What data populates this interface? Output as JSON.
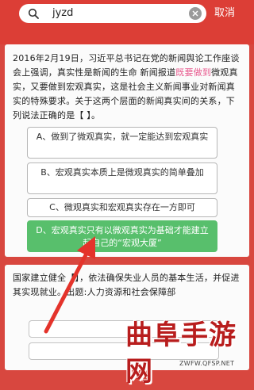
{
  "search": {
    "query": "jyzd",
    "cancel_label": "取消"
  },
  "question1": {
    "text_part1": "2016年2月19日，习近平总书记在党的新闻舆论工作座谈会上强调，真实性是新闻的生命 新闻报道",
    "highlight": "既要做到",
    "text_part2": "微观真实，又要做到宏观真实，这是社会主义新闻事业对新闻真实的特殊要求。关于这两个层面的新闻真实间的关系，下列说法正确的是【 】。",
    "options": [
      {
        "label": "A、做到了微观真实，就一定能达到宏观真实"
      },
      {
        "label": "B、宏观真实本质上是微观真实的简单叠加"
      },
      {
        "label": "C、微观真实和宏观真实存在一方即可"
      },
      {
        "label": "D、宏观真实只有以微观真实为基础才能建立起自己的“宏观大厦”"
      }
    ],
    "correct_color": "#58bf6c"
  },
  "question2": {
    "text_part1": "国家建立健全【",
    "text_part2": "】，依法确保失业人员的基本生活，并促进其实现就业。出题:人力资源和社会保障部"
  },
  "watermark": {
    "brand": "曲阜手游网",
    "url": "ZWFW.QFSP.NET"
  },
  "colors": {
    "header": "#dc3e36",
    "background": "#d8473f",
    "arrow": "#e4332b"
  }
}
